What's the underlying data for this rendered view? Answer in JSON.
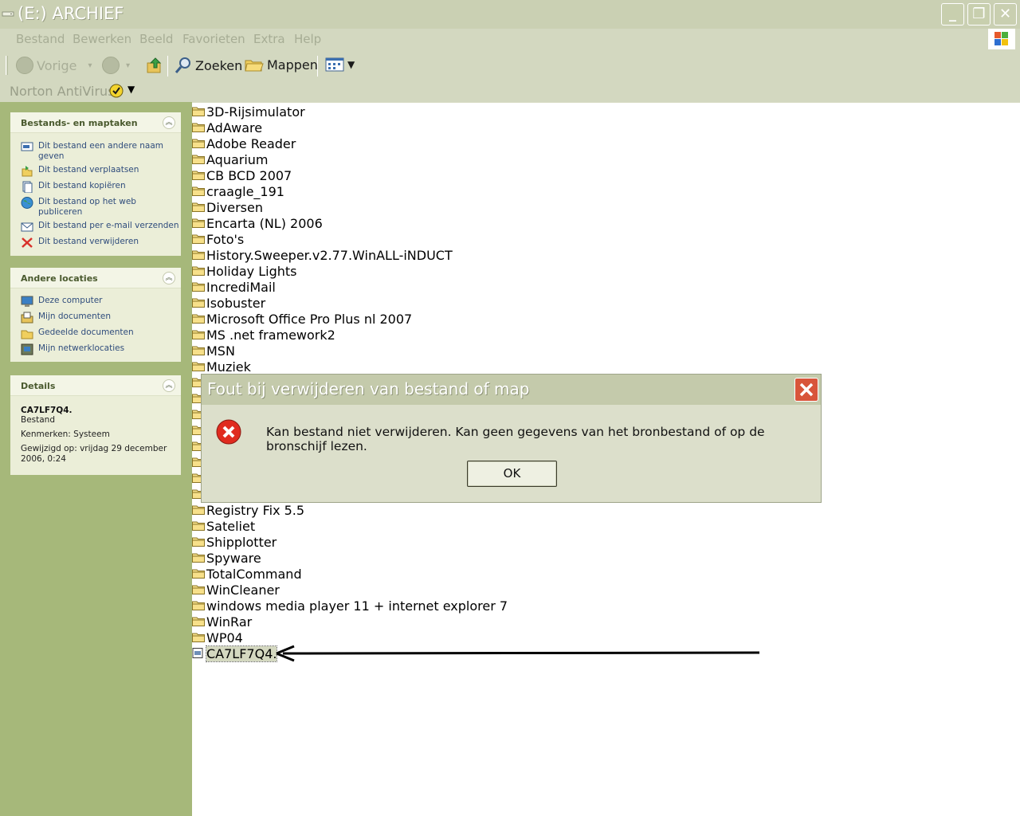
{
  "window": {
    "title": "(E:) ARCHIEF",
    "minimize": "_",
    "maximize": "❐",
    "close": "✕"
  },
  "menu": [
    "Bestand",
    "Bewerken",
    "Beeld",
    "Favorieten",
    "Extra",
    "Help"
  ],
  "toolbar": {
    "back_label": "Vorige",
    "search_label": "Zoeken",
    "folders_label": "Mappen"
  },
  "norton": {
    "label": "Norton AntiVirus"
  },
  "tasks_panel": {
    "title": "Bestands- en maptaken",
    "items": [
      {
        "label": "Dit bestand een andere naam geven",
        "icon": "rename-icon"
      },
      {
        "label": "Dit bestand verplaatsen",
        "icon": "move-icon"
      },
      {
        "label": "Dit bestand kopiëren",
        "icon": "copy-icon"
      },
      {
        "label": "Dit bestand op het web publiceren",
        "icon": "globe-icon"
      },
      {
        "label": "Dit bestand per e-mail verzenden",
        "icon": "mail-icon"
      },
      {
        "label": "Dit bestand verwijderen",
        "icon": "delete-icon"
      }
    ]
  },
  "locations_panel": {
    "title": "Andere locaties",
    "items": [
      {
        "label": "Deze computer",
        "icon": "computer-icon"
      },
      {
        "label": "Mijn documenten",
        "icon": "documents-icon"
      },
      {
        "label": "Gedeelde documenten",
        "icon": "shared-folder-icon"
      },
      {
        "label": "Mijn netwerklocaties",
        "icon": "network-icon"
      }
    ]
  },
  "details_panel": {
    "title": "Details",
    "name": "CA7LF7Q4.",
    "type": "Bestand",
    "attributes": "Kenmerken: Systeem",
    "modified": "Gewijzigd op: vrijdag 29 december 2006, 0:24"
  },
  "files": [
    "3D-Rijsimulator",
    "AdAware",
    "Adobe Reader",
    "Aquarium",
    "CB BCD 2007",
    "craagle_191",
    "Diversen",
    "Encarta (NL) 2006",
    "Foto's",
    "History.Sweeper.v2.77.WinALL-iNDUCT",
    "Holiday Lights",
    "IncrediMail",
    "Isobuster",
    "Microsoft Office Pro Plus nl 2007",
    "MS .net framework2",
    "MSN",
    "Muziek"
  ],
  "files_after": [
    "Registry Fix 5.5",
    "Sateliet",
    "Shipplotter",
    "Spyware",
    "TotalCommand",
    "WinCleaner",
    "windows media player 11 + internet explorer 7",
    "WinRar",
    "WP04"
  ],
  "selected_file": "CA7LF7Q4.",
  "dialog": {
    "title": "Fout bij verwijderen van bestand of map",
    "message": "Kan bestand niet verwijderen. Kan geen gegevens van het bronbestand of op de bronschijf lezen.",
    "ok_label": "OK"
  }
}
